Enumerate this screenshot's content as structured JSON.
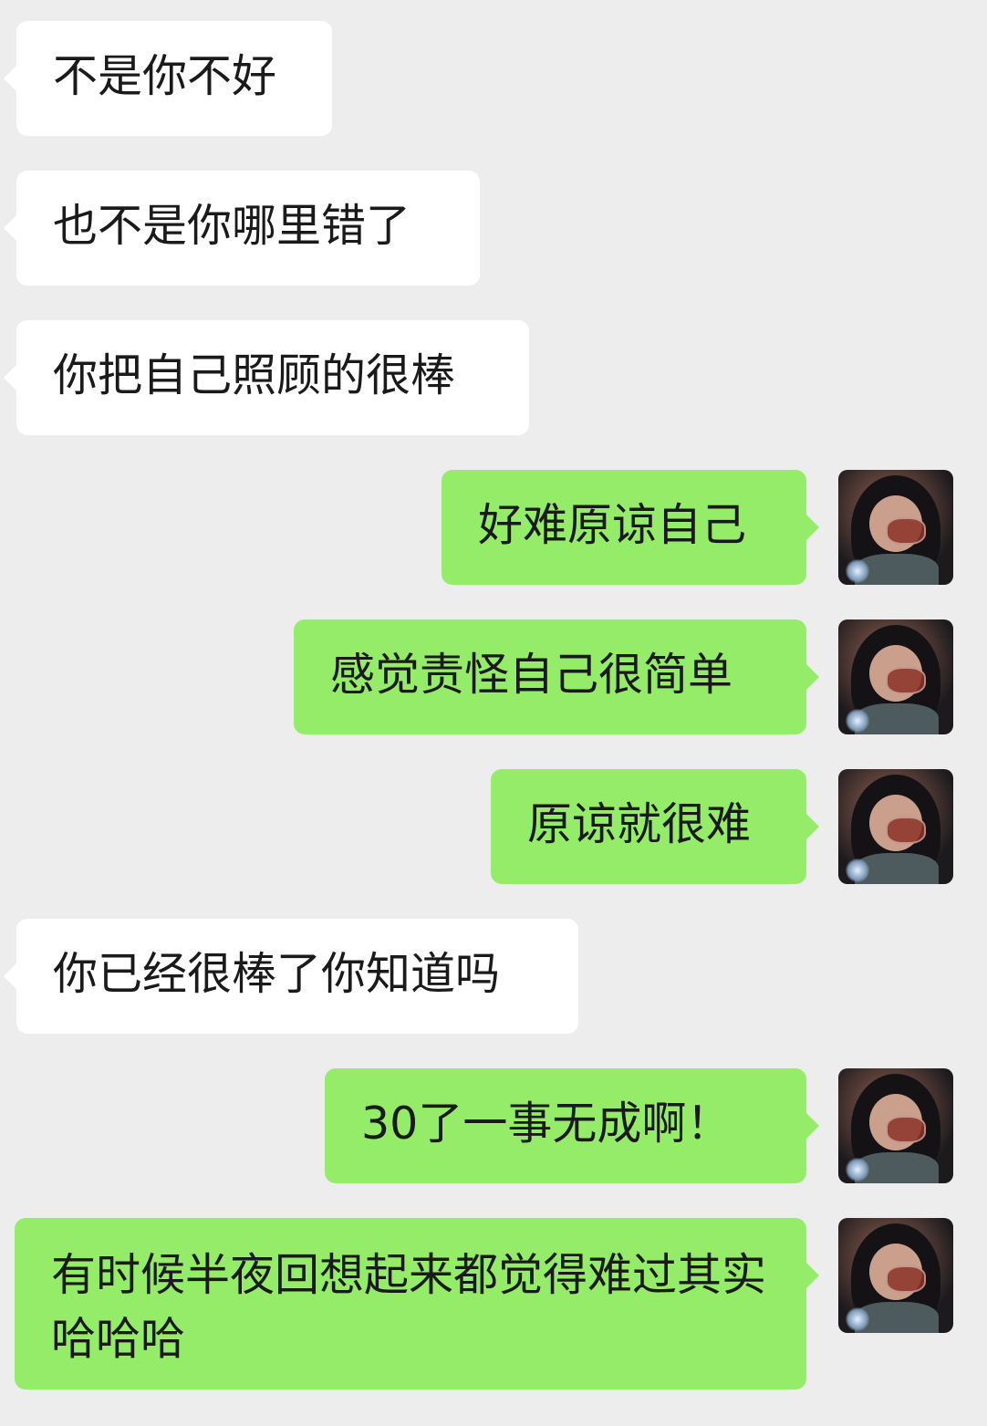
{
  "messages": [
    {
      "side": "received",
      "text": "不是你不好"
    },
    {
      "side": "received",
      "text": "也不是你哪里错了"
    },
    {
      "side": "received",
      "text": "你把自己照顾的很棒"
    },
    {
      "side": "sent",
      "text": "好难原谅自己",
      "avatar": "self-avatar"
    },
    {
      "side": "sent",
      "text": "感觉责怪自己很简单",
      "avatar": "self-avatar"
    },
    {
      "side": "sent",
      "text": "原谅就很难",
      "avatar": "self-avatar"
    },
    {
      "side": "received",
      "text": "你已经很棒了你知道吗"
    },
    {
      "side": "sent",
      "text": "30了一事无成啊！",
      "avatar": "self-avatar"
    },
    {
      "side": "sent",
      "text": "有时候半夜回想起来都觉得难过其实哈哈哈",
      "avatar": "self-avatar"
    }
  ],
  "colors": {
    "background": "#ededed",
    "received_bubble": "#ffffff",
    "sent_bubble": "#95ec69",
    "text": "#1a1a1a"
  }
}
